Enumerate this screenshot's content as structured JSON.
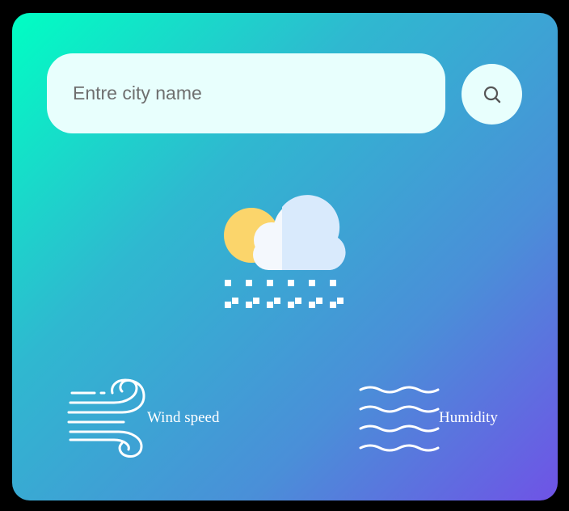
{
  "search": {
    "placeholder": "Entre city name",
    "value": "",
    "button_icon": "search-icon"
  },
  "weather": {
    "icon": "partly-cloudy-snow-icon"
  },
  "details": {
    "wind": {
      "icon": "wind-icon",
      "label": "Wind speed"
    },
    "humidity": {
      "icon": "humidity-waves-icon",
      "label": "Humidity"
    }
  },
  "colors": {
    "gradient_start": "#00ffc3",
    "gradient_end": "#6f53e6",
    "input_background": "#e8fffd",
    "text_on_card": "#ffffff"
  }
}
